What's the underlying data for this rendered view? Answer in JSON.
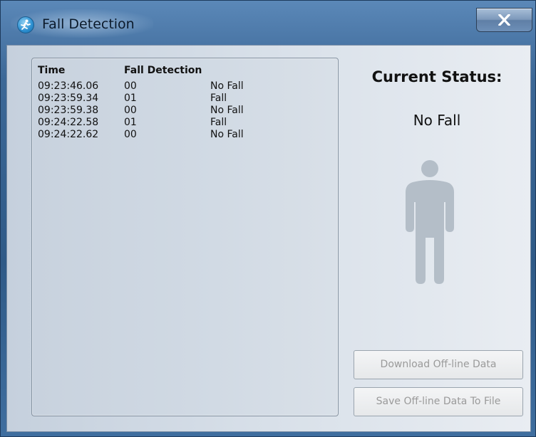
{
  "window": {
    "title": "Fall Detection",
    "close_label": "X",
    "app_icon": "running-person-icon"
  },
  "log": {
    "headers": {
      "time": "Time",
      "fall_detection": "Fall Detection"
    },
    "rows": [
      {
        "time": "09:23:46.06",
        "code": "00",
        "status": "No Fall"
      },
      {
        "time": "09:23:59.34",
        "code": "01",
        "status": "Fall"
      },
      {
        "time": "09:23:59.38",
        "code": "00",
        "status": "No Fall"
      },
      {
        "time": "09:24:22.58",
        "code": "01",
        "status": "Fall"
      },
      {
        "time": "09:24:22.62",
        "code": "00",
        "status": "No Fall"
      }
    ]
  },
  "status": {
    "title": "Current Status:",
    "value": "No Fall",
    "icon": "standing-person-icon"
  },
  "buttons": {
    "download": "Download Off-line Data",
    "save": "Save Off-line Data To File"
  },
  "colors": {
    "title_bar": "#3c6897",
    "person_icon": "#b4bec8",
    "disabled_text": "#9a9a9a"
  }
}
